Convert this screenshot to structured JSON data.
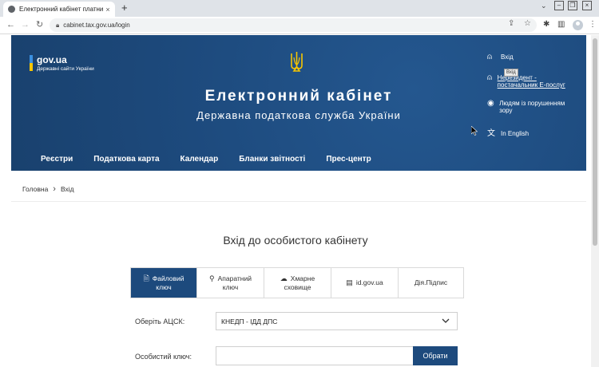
{
  "browser": {
    "tab_title": "Електронний кабінет платника",
    "tab_close": "×",
    "new_tab": "+",
    "url": "cabinet.tax.gov.ua/login"
  },
  "header": {
    "gov_logo_name": "gov.ua",
    "gov_logo_subtitle": "Державні сайти України",
    "title": "Електронний кабінет",
    "subtitle": "Державна податкова служба України",
    "side_links": [
      {
        "icon": "login-icon",
        "label": "Вхід"
      },
      {
        "icon": "user-icon",
        "label": "Нерезидент - постачальник Е-послуг"
      },
      {
        "icon": "eye-icon",
        "label": "Людям із порушенням зору"
      },
      {
        "icon": "translate-icon",
        "label": "In English"
      }
    ],
    "tooltip": "Вхід",
    "nav": [
      "Реєстри",
      "Податкова карта",
      "Календар",
      "Бланки звітності",
      "Прес-центр"
    ]
  },
  "breadcrumb": {
    "home": "Головна",
    "current": "Вхід"
  },
  "login": {
    "title": "Вхід до особистого кабінету",
    "methods": [
      {
        "line1": "Файловий",
        "line2": "ключ",
        "icon": "file-icon",
        "active": true
      },
      {
        "line1": "Апаратний",
        "line2": "ключ",
        "icon": "key-icon",
        "active": false
      },
      {
        "line1": "Хмарне",
        "line2": "сховище",
        "icon": "cloud-icon",
        "active": false
      },
      {
        "line1": "id.gov.ua",
        "line2": "",
        "icon": "id-card-icon",
        "active": false
      },
      {
        "line1": "Дія.Підпис",
        "line2": "",
        "icon": "",
        "active": false
      }
    ],
    "acsk_label": "Оберіть АЦСК:",
    "acsk_value": "КНЕДП - ІДД ДПС",
    "key_label": "Особистий ключ:",
    "key_value": "",
    "choose_button": "Обрати"
  },
  "colors": {
    "brand": "#1d4a7d",
    "flag_blue": "#3a8fe0",
    "flag_yellow": "#f6c500"
  }
}
